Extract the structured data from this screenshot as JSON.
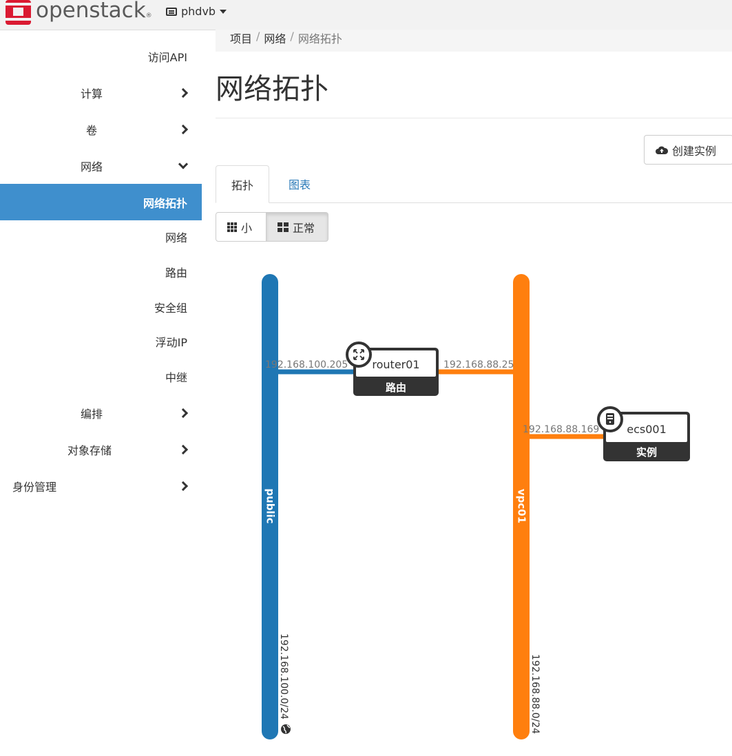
{
  "navbar": {
    "brand": "openstack",
    "brand_mark": "®",
    "project": "phdvb"
  },
  "sidebar": {
    "items": [
      {
        "label": "访问API",
        "type": "leaf"
      },
      {
        "label": "计算",
        "type": "collapsed"
      },
      {
        "label": "卷",
        "type": "collapsed"
      },
      {
        "label": "网络",
        "type": "expanded"
      },
      {
        "label": "网络拓扑",
        "type": "active"
      },
      {
        "label": "网络",
        "type": "leaf"
      },
      {
        "label": "路由",
        "type": "leaf"
      },
      {
        "label": "安全组",
        "type": "leaf"
      },
      {
        "label": "浮动IP",
        "type": "leaf"
      },
      {
        "label": "中继",
        "type": "leaf"
      },
      {
        "label": "编排",
        "type": "collapsed"
      },
      {
        "label": "对象存储",
        "type": "collapsed"
      },
      {
        "label": "身份管理",
        "type": "collapsed"
      }
    ]
  },
  "breadcrumb": [
    "项目",
    "网络",
    "网络拓扑"
  ],
  "page": {
    "title": "网络拓扑",
    "create_instance": "创建实例"
  },
  "tabs": [
    "拓扑",
    "图表"
  ],
  "size_toggle": [
    "小",
    "正常"
  ],
  "topology": {
    "networks": [
      {
        "name": "public",
        "cidr": "192.168.100.0/24",
        "color": "#1f77b4",
        "external": true
      },
      {
        "name": "vpc01",
        "cidr": "192.168.88.0/24",
        "color": "#ff7f0e",
        "external": false
      }
    ],
    "router": {
      "name": "router01",
      "type": "路由",
      "left_ip": "192.168.100.205",
      "right_ip": "192.168.88.25"
    },
    "instance": {
      "name": "ecs001",
      "type": "实例",
      "ip": "192.168.88.169"
    }
  },
  "colors": {
    "sidebar_active": "#3f8fcd",
    "link": "#2a7ab8",
    "brand_red": "#da1a32",
    "public_net": "#1f77b4",
    "private_net": "#ff7f0e",
    "node_dark": "#333333"
  }
}
